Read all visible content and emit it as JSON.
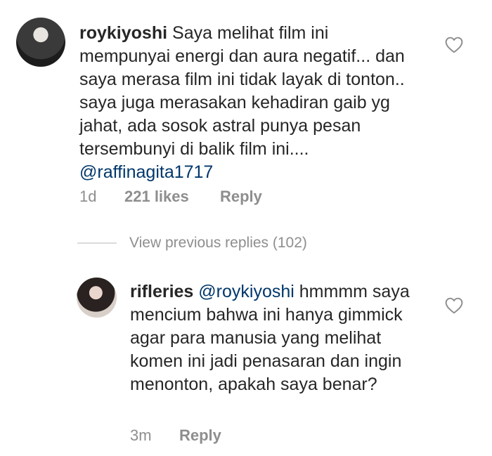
{
  "comments": [
    {
      "username": "roykiyoshi",
      "text": "Saya melihat film ini mempunyai energi dan aura negatif... dan saya merasa film ini tidak layak di tonton.. saya juga merasakan kehadiran gaib yg jahat, ada sosok astral punya pesan tersembunyi di balik film ini....",
      "mention": "@raffinagita1717",
      "time": "1d",
      "likes": "221 likes",
      "reply_label": "Reply",
      "like_icon": "heart-outline-icon"
    },
    {
      "username": "rifleries",
      "mention": "@roykiyoshi",
      "text": "hmmmm saya mencium bahwa ini hanya gimmick agar para manusia yang melihat komen ini jadi penasaran dan ingin menonton, apakah saya benar?",
      "time": "3m",
      "reply_label": "Reply",
      "like_icon": "heart-outline-icon"
    }
  ],
  "view_replies": "View previous replies (102)",
  "colors": {
    "text": "#262626",
    "meta": "#8e8e8e",
    "mention": "#00376b",
    "divider": "#dbdbdb"
  }
}
